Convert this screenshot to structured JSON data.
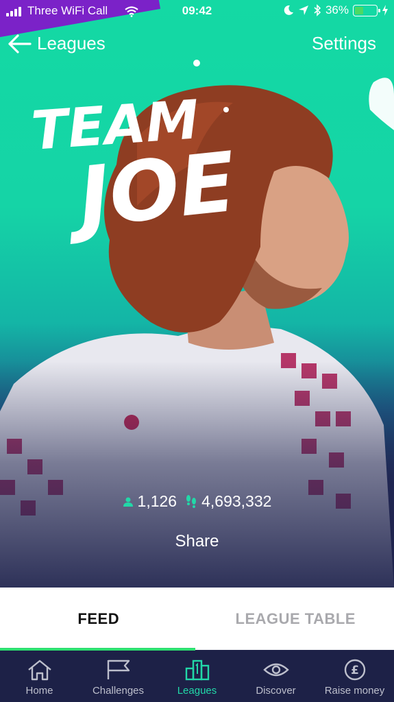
{
  "status_bar": {
    "carrier": "Three WiFi Call",
    "time": "09:42",
    "battery": "36%"
  },
  "nav": {
    "back_label": "Leagues",
    "settings_label": "Settings"
  },
  "hero": {
    "title_line1": "TEAM",
    "title_line2": "JOE"
  },
  "stats": {
    "members": "1,126",
    "steps": "4,693,332"
  },
  "share_label": "Share",
  "tabs": [
    {
      "label": "FEED",
      "active": true
    },
    {
      "label": "LEAGUE TABLE",
      "active": false
    }
  ],
  "bottom_nav": [
    {
      "label": "Home",
      "icon": "home-icon"
    },
    {
      "label": "Challenges",
      "icon": "flag-icon"
    },
    {
      "label": "Leagues",
      "icon": "leagues-icon",
      "active": true
    },
    {
      "label": "Discover",
      "icon": "eye-icon"
    },
    {
      "label": "Raise money",
      "icon": "pound-icon"
    }
  ],
  "colors": {
    "accent": "#22d8a8",
    "hero_teal": "#14d9a4",
    "navy": "#1d2147",
    "tab_indicator": "#2ee070",
    "carrier_banner": "#7b22c8"
  }
}
